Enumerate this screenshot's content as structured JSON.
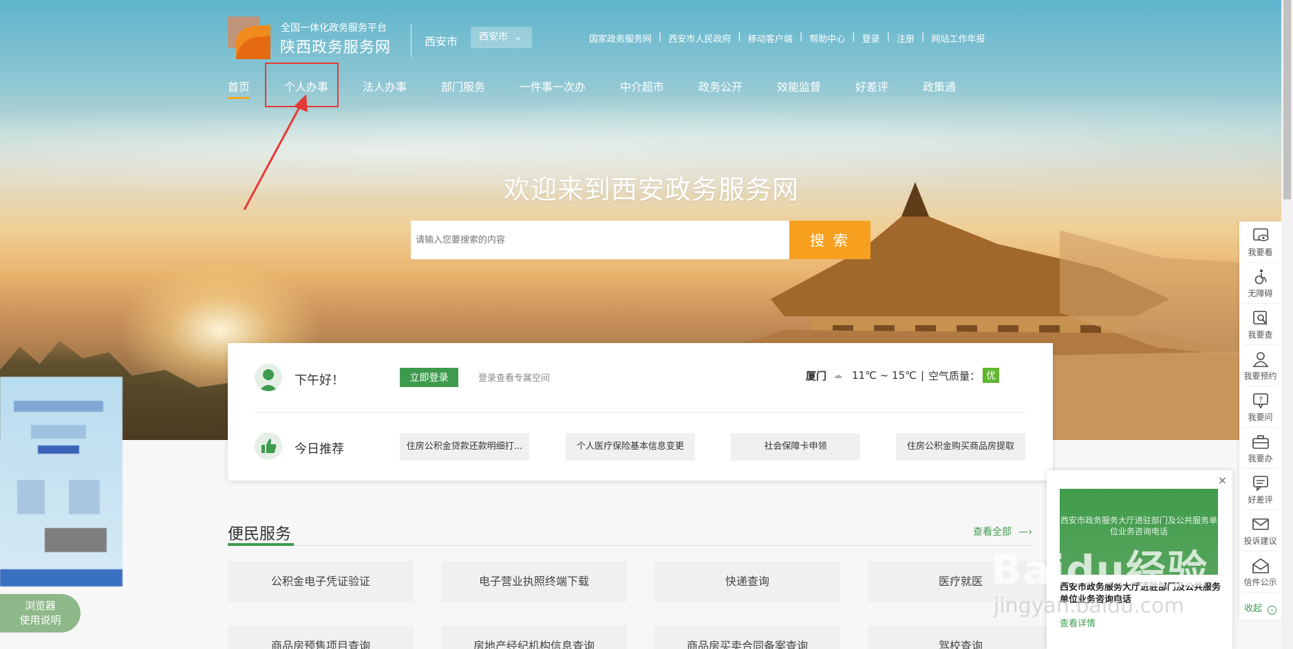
{
  "header": {
    "logo_subtitle": "全国一体化政务服务平台",
    "logo_title": "陕西政务服务网",
    "city_label": "西安市",
    "city_select_value": "西安市",
    "top_links": [
      "国家政务服务网",
      "西安市人民政府",
      "移动客户端",
      "帮助中心",
      "登录",
      "注册",
      "网站工作年报"
    ],
    "link_separator": "|"
  },
  "nav": {
    "items": [
      "首页",
      "个人办事",
      "法人办事",
      "部门服务",
      "一件事一次办",
      "中介超市",
      "政务公开",
      "效能监督",
      "好差评",
      "政策通"
    ],
    "active": "首页",
    "highlighted": "个人办事"
  },
  "hero": {
    "welcome": "欢迎来到西安政务服务网",
    "search_placeholder": "请输入您要搜索的内容",
    "search_button": "搜 索"
  },
  "card": {
    "greeting": "下午好！",
    "login_button": "立即登录",
    "login_tip": "登录查看专属空间",
    "weather": {
      "city": "厦门",
      "icon": "cloud-icon",
      "temp": "11℃ ~ 15℃",
      "sep": "|",
      "air_label": "空气质量：",
      "air_value": "优"
    },
    "recommend_title": "今日推荐",
    "recommend_items": [
      "住房公积金贷款还款明细打...",
      "个人医疗保险基本信息变更",
      "社会保障卡申领",
      "住房公积金购买商品房提取"
    ]
  },
  "services": {
    "title": "便民服务",
    "view_all": "查看全部",
    "view_all_arrow": "—›",
    "row1": [
      "公积金电子凭证验证",
      "电子营业执照终端下载",
      "快递查询",
      "医疗就医"
    ],
    "row2": [
      "商品房预售项目查询",
      "房地产经纪机构信息查询",
      "商品房买卖合同备案查询",
      "驾校查询"
    ]
  },
  "left_float": {
    "help_line1": "浏览器",
    "help_line2": "使用说明"
  },
  "right_bar": {
    "items": [
      {
        "label": "我要看",
        "icon": "eye-icon"
      },
      {
        "label": "无障碍",
        "icon": "accessibility-icon"
      },
      {
        "label": "我要查",
        "icon": "search-doc-icon"
      },
      {
        "label": "我要预约",
        "icon": "person-icon"
      },
      {
        "label": "我要问",
        "icon": "question-icon"
      },
      {
        "label": "我要办",
        "icon": "briefcase-icon"
      },
      {
        "label": "好差评",
        "icon": "comment-icon"
      },
      {
        "label": "投诉建议",
        "icon": "mail-icon"
      },
      {
        "label": "信件公示",
        "icon": "envelope-open-icon"
      }
    ],
    "collapse": "收起"
  },
  "popup": {
    "close": "×",
    "image_text": "西安市政务服务大厅进驻部门及公共服务单位业务咨询电话",
    "title": "西安市政务服务大厅进驻部门及公共服务单位业务咨询电话",
    "link": "查看详情"
  },
  "watermark": {
    "text": "Baidu经验",
    "url": "jingyan.baidu.com"
  },
  "colors": {
    "accent_green": "#3e9b4e",
    "accent_orange": "#f7a020",
    "annotation_red": "#e53935"
  }
}
